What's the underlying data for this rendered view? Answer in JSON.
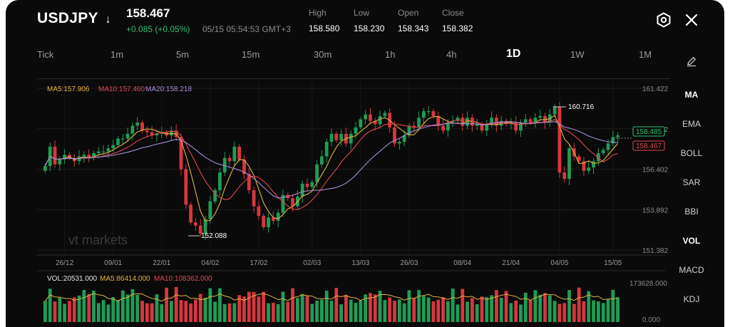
{
  "header": {
    "symbol": "USDJPY",
    "symbol_arrow": "↓",
    "price": "158.467",
    "change": "+0.085 (+0.05%)",
    "timestamp": "05/15 05:54:53 GMT+3",
    "stats": [
      {
        "label": "High",
        "value": "158.580"
      },
      {
        "label": "Low",
        "value": "158.230"
      },
      {
        "label": "Open",
        "value": "158.343"
      },
      {
        "label": "Close",
        "value": "158.382"
      }
    ],
    "settings_icon": "gear-icon",
    "close_icon": "close-icon"
  },
  "timeframes": {
    "items": [
      "Tick",
      "1m",
      "5m",
      "15m",
      "30m",
      "1h",
      "4h",
      "1D",
      "1W",
      "1M"
    ],
    "active": "1D"
  },
  "indicators_menu": {
    "draw_icon": "pencil-icon",
    "items": [
      "MA",
      "EMA",
      "BOLL",
      "SAR",
      "BBI",
      "VOL",
      "MACD",
      "KDJ"
    ],
    "active": [
      "MA",
      "VOL"
    ]
  },
  "colors": {
    "up": "#1f9d55",
    "down": "#d9363e",
    "ma5": "#e3b341",
    "ma10": "#e0484f",
    "ma20": "#a78bd8",
    "bid_box": "#2fbf71",
    "ask_box": "#e0484f"
  },
  "main_legend": {
    "ma5": "MA5:157.906",
    "ma10": "MA10:157.460",
    "ma20": "MA20:158.218"
  },
  "vol_legend": {
    "vol": "VOL:20531.000",
    "ma5": "MA5:86414.000",
    "ma10": "MA10:108362.000"
  },
  "watermark": "vt markets",
  "chart_data": [
    {
      "type": "candlestick",
      "title": "",
      "price_axis_ticks": [
        "161.422",
        "158.912",
        "156.402",
        "153.892",
        "151.382"
      ],
      "ylim": [
        151.382,
        161.422
      ],
      "date_ticks": [
        "26/12",
        "09/01",
        "22/01",
        "04/02",
        "17/02",
        "02/03",
        "13/03",
        "26/03",
        "08/04",
        "21/04",
        "04/05",
        "15/05"
      ],
      "current_bid": "158.485",
      "current_ask": "158.467",
      "annotations": [
        {
          "label": "160.716",
          "value": 160.716,
          "type": "high"
        },
        {
          "label": "152.088",
          "value": 152.088,
          "type": "low"
        }
      ],
      "close": [
        156.6,
        157.8,
        156.7,
        157.0,
        157.3,
        157.1,
        156.9,
        157.2,
        157.3,
        157.1,
        157.4,
        157.5,
        157.5,
        157.7,
        157.9,
        158.3,
        158.3,
        158.6,
        159.1,
        159.3,
        158.8,
        158.7,
        158.5,
        158.6,
        158.7,
        158.5,
        158.8,
        158.4,
        156.4,
        154.2,
        153.1,
        152.9,
        152.4,
        153.3,
        154.4,
        155.1,
        156.2,
        157.1,
        156.9,
        157.8,
        157.0,
        156.1,
        155.1,
        154.1,
        153.5,
        152.8,
        153.4,
        153.2,
        153.7,
        154.8,
        154.6,
        154.1,
        154.7,
        155.5,
        155.3,
        155.6,
        156.7,
        157.2,
        158.1,
        158.6,
        158.2,
        158.6,
        158.0,
        158.6,
        159.0,
        159.5,
        159.8,
        159.4,
        159.2,
        159.7,
        159.9,
        159.0,
        158.0,
        158.1,
        158.5,
        159.1,
        159.0,
        159.6,
        160.0,
        160.0,
        159.7,
        159.1,
        158.8,
        159.3,
        159.4,
        159.6,
        159.1,
        159.6,
        159.1,
        159.2,
        158.8,
        159.2,
        159.6,
        159.1,
        159.4,
        159.2,
        159.3,
        158.8,
        159.3,
        159.5,
        159.3,
        159.6,
        159.7,
        159.3,
        159.8,
        160.3,
        156.2,
        155.8,
        157.7,
        157.2,
        156.9,
        156.3,
        156.5,
        156.9,
        157.4,
        157.6,
        158.0,
        158.4,
        158.5
      ]
    },
    {
      "type": "bar",
      "title": "",
      "series_name": "VOL",
      "ylim": [
        0,
        173628
      ],
      "axis_ticks": [
        "173628.000",
        "0.000"
      ],
      "ma5": "86414.000",
      "ma10": "108362.000"
    }
  ]
}
